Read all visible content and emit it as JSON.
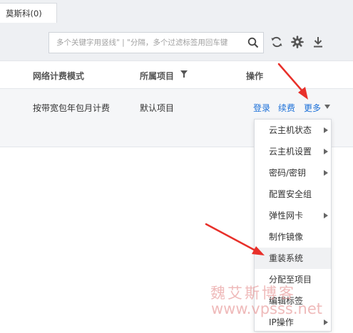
{
  "region_tab": "莫斯科(0)",
  "search": {
    "placeholder": "多个关键字用竖线\" | \"分隔，多个过滤标签用回车键"
  },
  "toolbar": {
    "search_icon": "search-icon",
    "refresh_icon": "refresh-icon",
    "settings_icon": "gear-icon",
    "download_icon": "download-icon"
  },
  "table": {
    "columns": [
      "网络计费模式",
      "所属项目",
      "操作"
    ],
    "rows": [
      {
        "billing_mode": "按带宽包年包月计费",
        "project": "默认项目",
        "ops": [
          "登录",
          "续费",
          "更多"
        ]
      }
    ]
  },
  "more_menu": {
    "items": [
      {
        "label": "云主机状态",
        "submenu": true
      },
      {
        "label": "云主机设置",
        "submenu": true
      },
      {
        "label": "密码/密钥",
        "submenu": true
      },
      {
        "label": "配置安全组",
        "submenu": false
      },
      {
        "label": "弹性网卡",
        "submenu": true
      },
      {
        "label": "制作镜像",
        "submenu": false
      },
      {
        "label": "重装系统",
        "submenu": false
      },
      {
        "label": "分配至项目",
        "submenu": false
      },
      {
        "label": "编辑标签",
        "submenu": false
      },
      {
        "label": "IP操作",
        "submenu": true
      }
    ]
  },
  "watermark": {
    "name": "魏艾斯博客",
    "url": "www.vpsss.net"
  },
  "colors": {
    "link": "#1a6fd8",
    "annotation_arrow": "#e8302a"
  }
}
